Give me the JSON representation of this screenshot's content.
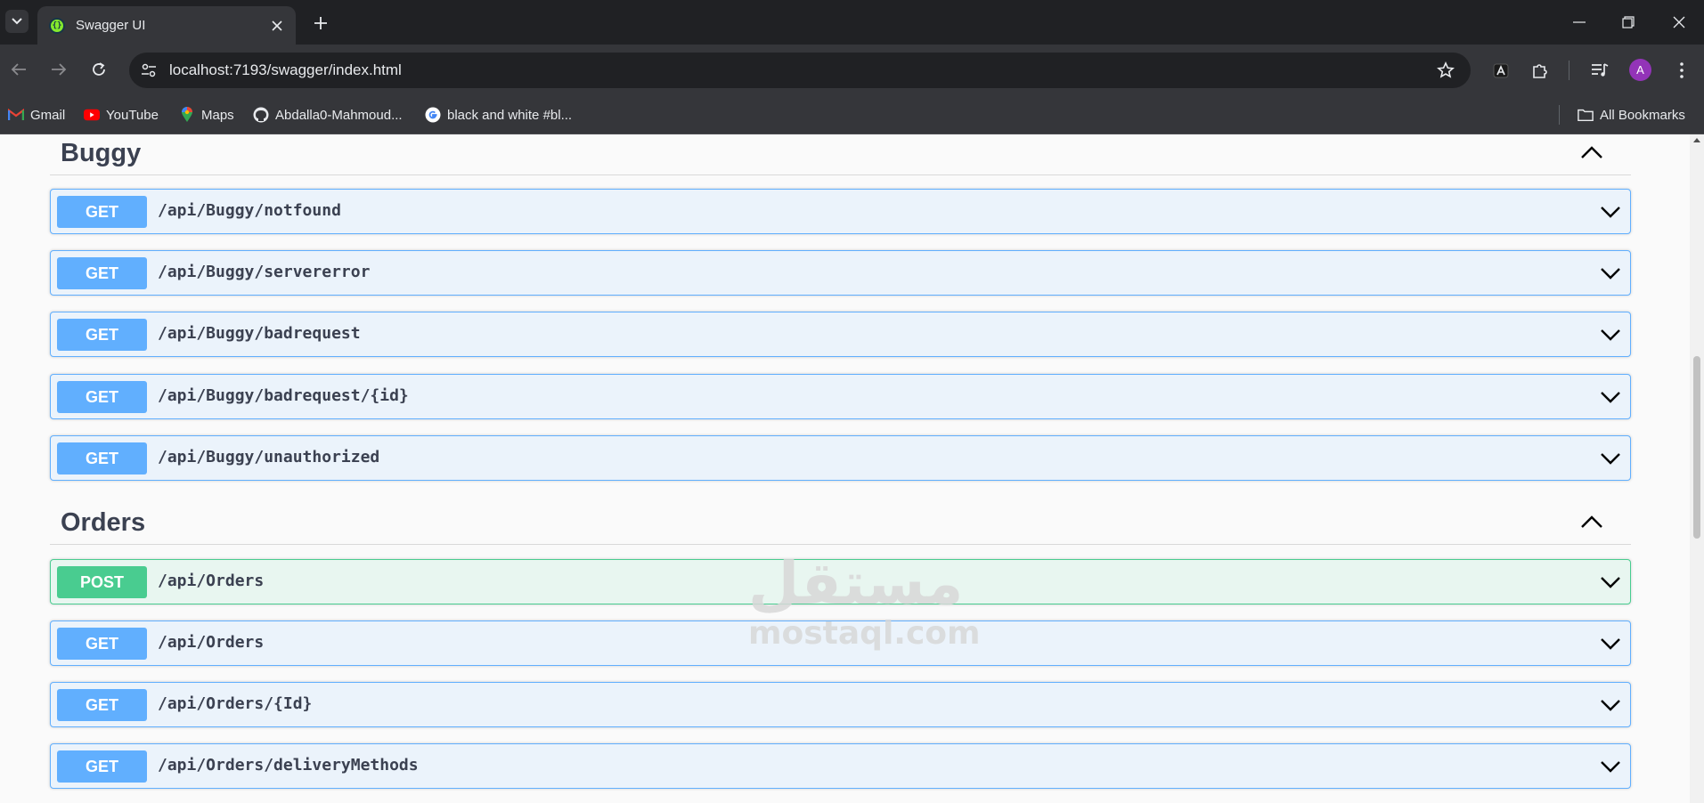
{
  "browser": {
    "tab": {
      "title": "Swagger UI",
      "favicon_text": "{}"
    },
    "url": "localhost:7193/swagger/index.html",
    "profile_initial": "A",
    "bookmarks": [
      {
        "label": "Gmail",
        "icon": "gmail-icon"
      },
      {
        "label": "YouTube",
        "icon": "youtube-icon"
      },
      {
        "label": "Maps",
        "icon": "maps-icon"
      },
      {
        "label": "Abdalla0-Mahmoud...",
        "icon": "github-icon"
      },
      {
        "label": "black and white #bl...",
        "icon": "google-icon"
      }
    ],
    "all_bookmarks_label": "All Bookmarks"
  },
  "swagger": {
    "sections": [
      {
        "name": "Buggy",
        "operations": [
          {
            "method": "GET",
            "path": "/api/Buggy/notfound"
          },
          {
            "method": "GET",
            "path": "/api/Buggy/servererror"
          },
          {
            "method": "GET",
            "path": "/api/Buggy/badrequest"
          },
          {
            "method": "GET",
            "path": "/api/Buggy/badrequest/{id}"
          },
          {
            "method": "GET",
            "path": "/api/Buggy/unauthorized"
          }
        ]
      },
      {
        "name": "Orders",
        "operations": [
          {
            "method": "POST",
            "path": "/api/Orders"
          },
          {
            "method": "GET",
            "path": "/api/Orders"
          },
          {
            "method": "GET",
            "path": "/api/Orders/{Id}"
          },
          {
            "method": "GET",
            "path": "/api/Orders/deliveryMethods"
          }
        ]
      }
    ]
  },
  "watermark": {
    "arabic": "مستقل",
    "latin": "mostaql.com"
  },
  "colors": {
    "get": "#61affe",
    "post": "#49cc90",
    "chrome_dark": "#202124",
    "chrome_toolbar": "#35363a"
  }
}
